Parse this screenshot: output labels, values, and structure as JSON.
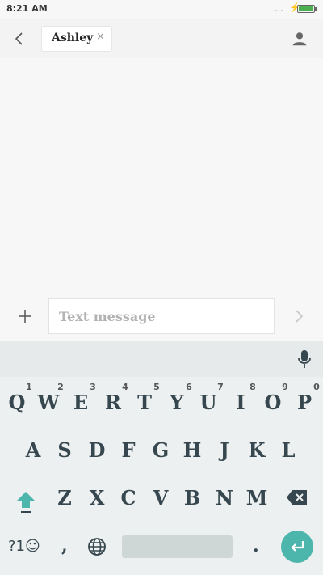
{
  "status": {
    "time": "8:21 AM",
    "overflow": "...",
    "battery_level": 1.0
  },
  "header": {
    "contact_name": "Ashley",
    "chip_close": "×"
  },
  "compose": {
    "placeholder": "Text message"
  },
  "keyboard": {
    "row1": [
      {
        "key": "Q",
        "num": "1"
      },
      {
        "key": "W",
        "num": "2"
      },
      {
        "key": "E",
        "num": "3"
      },
      {
        "key": "R",
        "num": "4"
      },
      {
        "key": "T",
        "num": "5"
      },
      {
        "key": "Y",
        "num": "6"
      },
      {
        "key": "U",
        "num": "7"
      },
      {
        "key": "I",
        "num": "8"
      },
      {
        "key": "O",
        "num": "9"
      },
      {
        "key": "P",
        "num": "0"
      }
    ],
    "row2": [
      "A",
      "S",
      "D",
      "F",
      "G",
      "H",
      "J",
      "K",
      "L"
    ],
    "row3": [
      "Z",
      "X",
      "C",
      "V",
      "B",
      "N",
      "M"
    ],
    "symbols": "?1☺",
    "comma": ",",
    "period": "."
  },
  "colors": {
    "accent": "#4db6ac",
    "key_text": "#37474f"
  }
}
